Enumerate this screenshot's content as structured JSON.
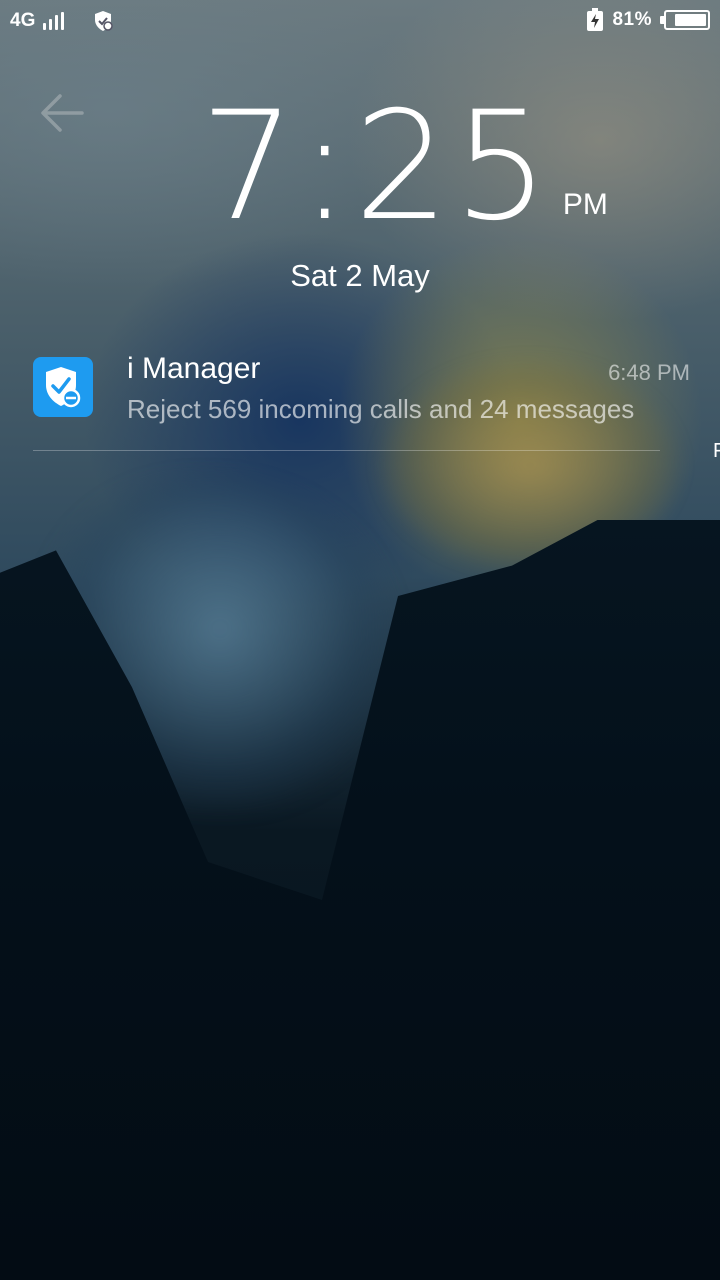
{
  "status_bar": {
    "network": "4G",
    "signal_icon": "signal-strength-icon",
    "security_icon": "shield-icon",
    "charging_icon": "charging-icon",
    "battery_percent": "81%",
    "battery_level": 0.81
  },
  "lockscreen": {
    "back_icon": "back-arrow-icon",
    "time": "7:25",
    "ampm": "PM",
    "date": "Sat 2 May"
  },
  "notification": {
    "app_icon": "i-manager-shield-icon",
    "app_name": "i Manager",
    "time": "6:48 PM",
    "text": "Reject 569 incoming calls and 24 messages",
    "icon_color": "#1e9bf0"
  },
  "edge_text": "F"
}
